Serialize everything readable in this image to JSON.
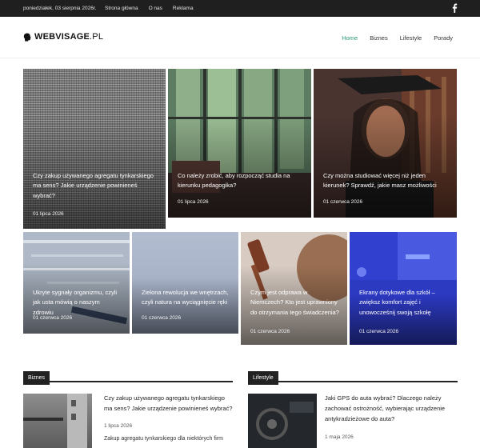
{
  "topbar": {
    "date": "poniedziałek, 03 sierpnia 2026r.",
    "links": [
      "Strona główna",
      "O nas",
      "Reklama"
    ],
    "social_icon": "facebook-icon"
  },
  "header": {
    "logo_main": "WEBVISAGE",
    "logo_suffix": ".PL",
    "nav": [
      "Home",
      "Biznes",
      "Lifestyle",
      "Porady"
    ],
    "accent": "#2a9d6f"
  },
  "featured": [
    {
      "title": "Czy zakup używanego agregatu tynkarskiego ma sens? Jakie urządzenie powinieneś wybrać?",
      "date": "01 lipca 2026"
    },
    {
      "title": "Co należy zrobić, aby rozpocząć studia na kierunku pedagogika?",
      "date": "01 lipca 2026"
    },
    {
      "title": "Czy można studiować więcej niż jeden kierunek? Sprawdź, jakie masz możliwości",
      "date": "01 czerwca 2026"
    },
    {
      "title": "Ukryte sygnały organizmu, czyli jak usta mówią o naszym zdrowiu",
      "date": "01 czerwca 2026"
    },
    {
      "title": "Zielona rewolucja we wnętrzach, czyli natura na wyciągnięcie ręki",
      "date": "01 czerwca 2026"
    },
    {
      "title": "Czym jest odprawa w Niemczech? Kto jest uprawniony do otrzymania tego świadczenia?",
      "date": "01 czerwca 2026"
    },
    {
      "title": "Ekrany dotykowe dla szkół – zwiększ komfort zajęć i unowocześnij swoją szkołę",
      "date": "01 czerwca 2026"
    }
  ],
  "sections": {
    "biznes": {
      "label": "Biznes",
      "article_title": "Czy zakup używanego agregatu tynkarskiego ma sens? Jakie urządzenie powinieneś wybrać?",
      "article_date": "1 lipca 2026",
      "article_excerpt": "Zakup agregatu tynkarskiego dla niektórych firm"
    },
    "lifestyle": {
      "label": "Lifestyle",
      "article_title": "Jaki GPS do auta wybrać? Dlaczego należy zachować ostrożność, wybierając urządzenie antykradzieżowe do auta?",
      "article_date": "1 maja 2026"
    }
  }
}
